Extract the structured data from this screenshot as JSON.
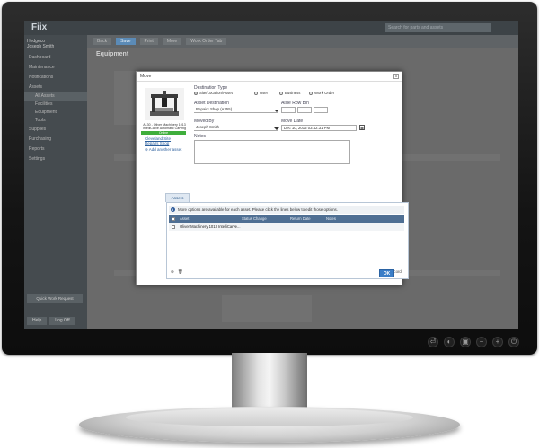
{
  "app": {
    "logo": "Fiix",
    "search_placeholder": "Search for parts and assets",
    "user_line1": "Hedgeco",
    "user_line2": "Joseph Smith"
  },
  "sidebar": {
    "items": [
      {
        "label": "Dashboard"
      },
      {
        "label": "Maintenance"
      },
      {
        "label": "Notifications"
      },
      {
        "label": "Assets"
      },
      {
        "label": "All Assets"
      },
      {
        "label": "Facilities"
      },
      {
        "label": "Equipment"
      },
      {
        "label": "Tools"
      },
      {
        "label": "Supplies"
      },
      {
        "label": "Purchasing"
      },
      {
        "label": "Reports"
      },
      {
        "label": "Settings"
      }
    ],
    "bottom_button": "Quick Work Request",
    "footer_left": "Help",
    "footer_right": "Log Off"
  },
  "toolbar": {
    "items": [
      "Back",
      "Save",
      "Print",
      "More",
      "Work Order Tab"
    ]
  },
  "page": {
    "title": "Equipment"
  },
  "dialog": {
    "title": "Move",
    "close": "x",
    "asset_caption": "A130 - Oliver Machinery 1013 IntelliCarve Automatic Carving Machine",
    "asset_status": "Online",
    "location_link_1": "Cleveland Site",
    "location_link_2": "Repairs Shop",
    "add_another": "Add another asset",
    "destination_type_label": "Destination Type",
    "radio_options": [
      {
        "label": "Site/Location/Asset",
        "selected": true
      },
      {
        "label": "User",
        "selected": false
      },
      {
        "label": "Business",
        "selected": false
      },
      {
        "label": "Work Order",
        "selected": false
      }
    ],
    "asset_destination_label": "Asset Destination",
    "asset_destination_value": "Repairs Shop (A355)",
    "aisle_row_bin_label": "Aisle Row Bin",
    "moved_by_label": "Moved By",
    "moved_by_value": "Joseph Smith",
    "move_date_label": "Move Date",
    "move_date_value": "Dec 10, 2015 03:42:31 PM",
    "notes_label": "Notes",
    "assets_tab": "Assets",
    "info_text": "More options are available for each asset. Please click the lines below to edit those options.",
    "columns": [
      "Asset",
      "Status Change",
      "Return Date",
      "Notes"
    ],
    "rows": [
      {
        "asset": "Oliver Machinery 1013 IntelliCarve..."
      }
    ],
    "record_count": "1 record.",
    "ok_label": "OK"
  }
}
